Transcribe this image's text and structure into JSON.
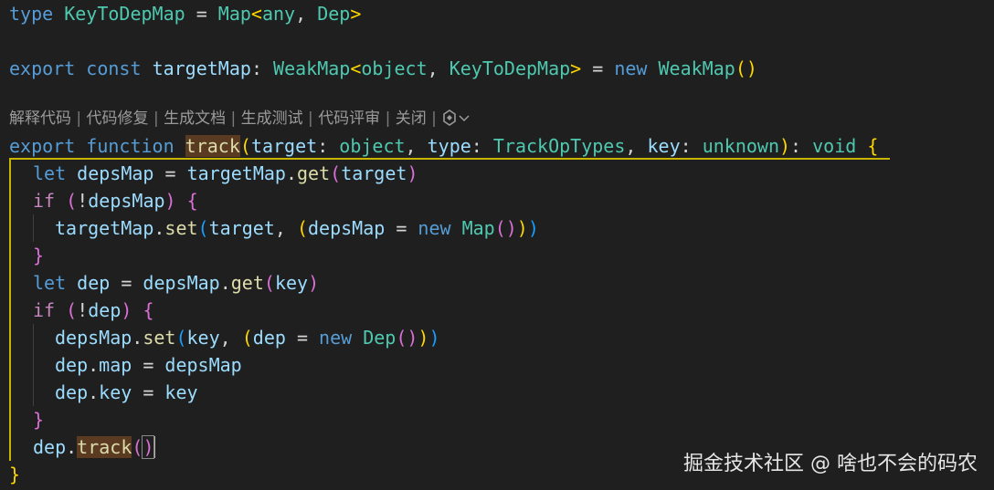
{
  "editor": {
    "codelens": {
      "items": [
        "解释代码",
        "代码修复",
        "生成文档",
        "生成测试",
        "代码评审",
        "关闭"
      ],
      "separator": " | "
    },
    "lines": {
      "l1": {
        "kw": "type",
        "name": "KeyToDepMap",
        "eq": " = ",
        "map": "Map",
        "lt": "<",
        "any": "any",
        "comma": ", ",
        "dep": "Dep",
        "gt": ">"
      },
      "l3": {
        "export": "export",
        "const": "const",
        "name": "targetMap",
        "colon": ": ",
        "weakmap": "WeakMap",
        "lt": "<",
        "object": "object",
        "comma": ", ",
        "ktd": "KeyToDepMap",
        "gt": ">",
        "eq": " = ",
        "new": "new",
        "weakmap2": "WeakMap",
        "paren": "()"
      },
      "l5": {
        "export": "export",
        "function": "function",
        "name": "track",
        "p1": "(",
        "target": "target",
        "c1": ": ",
        "object": "object",
        "comma1": ", ",
        "type": "type",
        "c2": ": ",
        "tot": "TrackOpTypes",
        "comma2": ", ",
        "key": "key",
        "c3": ": ",
        "unknown": "unknown",
        "p2": ")",
        "c4": ": ",
        "void": "void",
        "brace": "{"
      },
      "l6": {
        "let": "let",
        "name": "depsMap",
        "eq": " = ",
        "tm": "targetMap",
        "dot": ".",
        "get": "get",
        "p1": "(",
        "target": "target",
        "p2": ")"
      },
      "l7": {
        "if": "if",
        "p1": "(",
        "not": "!",
        "dm": "depsMap",
        "p2": ")",
        "brace": "{"
      },
      "l8": {
        "tm": "targetMap",
        "dot": ".",
        "set": "set",
        "p1": "(",
        "target": "target",
        "comma": ", ",
        "p2": "(",
        "dm": "depsMap",
        "eq": " = ",
        "new": "new",
        "map": "Map",
        "p3": "()",
        "p4": ")",
        "p5": ")"
      },
      "l9": {
        "brace": "}"
      },
      "l10": {
        "let": "let",
        "name": "dep",
        "eq": " = ",
        "dm": "depsMap",
        "dot": ".",
        "get": "get",
        "p1": "(",
        "key": "key",
        "p2": ")"
      },
      "l11": {
        "if": "if",
        "p1": "(",
        "not": "!",
        "dep": "dep",
        "p2": ")",
        "brace": "{"
      },
      "l12": {
        "dm": "depsMap",
        "dot": ".",
        "set": "set",
        "p1": "(",
        "key": "key",
        "comma": ", ",
        "p2": "(",
        "dep": "dep",
        "eq": " = ",
        "new": "new",
        "Dep": "Dep",
        "p3": "()",
        "p4": ")",
        "p5": ")"
      },
      "l13": {
        "dep": "dep",
        "dot": ".",
        "map": "map",
        "eq": " = ",
        "dm": "depsMap"
      },
      "l14": {
        "dep": "dep",
        "dot": ".",
        "key": "key",
        "eq": " = ",
        "val": "key"
      },
      "l15": {
        "brace": "}"
      },
      "l16": {
        "dep": "dep",
        "dot": ".",
        "track": "track",
        "p1": "(",
        "p2": ")"
      },
      "l17": {
        "brace": "}"
      }
    }
  },
  "watermark": "掘金技术社区 @ 啥也不会的码农",
  "colors": {
    "background": "#1f1f1f",
    "keyword": "#569cd6",
    "type": "#4ec9b0",
    "variable": "#9cdcfe",
    "function": "#dcdcaa",
    "control": "#c586c0"
  }
}
